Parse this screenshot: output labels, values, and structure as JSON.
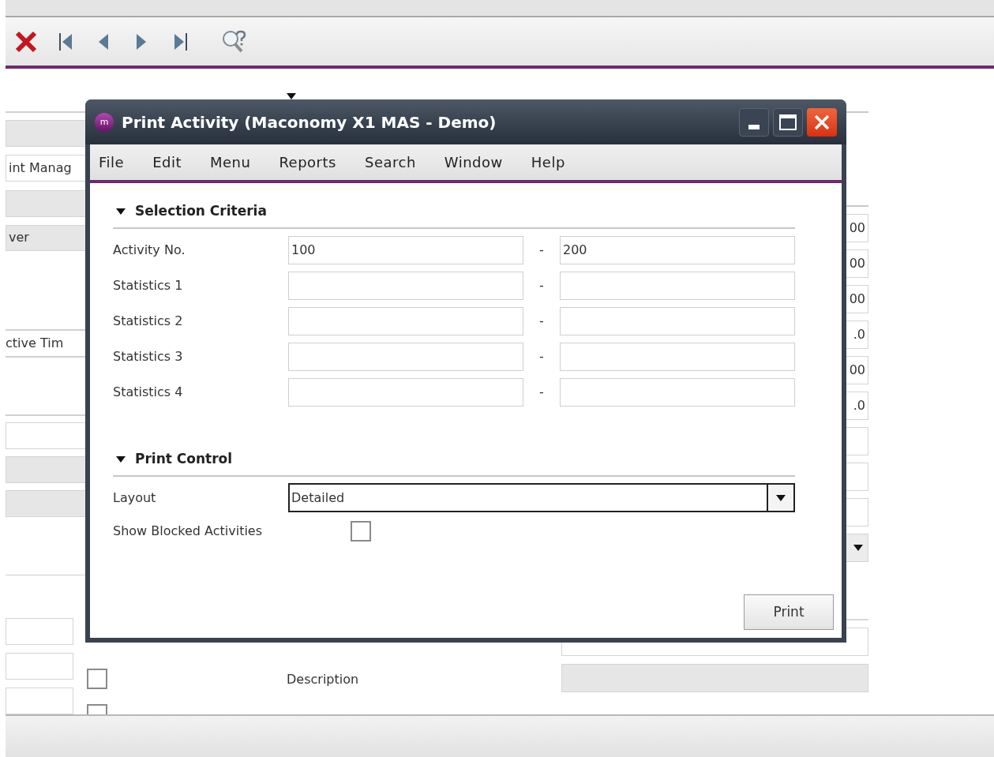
{
  "toolbar": [
    {
      "kind": "delete"
    },
    {
      "kind": "first"
    },
    {
      "kind": "previous"
    },
    {
      "kind": "next"
    },
    {
      "kind": "last"
    },
    {
      "kind": "search_help"
    }
  ],
  "form": {
    "left": [
      {
        "disabled": true
      },
      {
        "value": "int Manag",
        "disabled": false
      },
      {
        "disabled": true
      },
      {
        "value": "ver",
        "disabled": true
      }
    ],
    "left_label": "ctive Tim",
    "left_lower": [
      {
        "disabled": false
      },
      {
        "disabled": true
      },
      {
        "disabled": true
      }
    ],
    "left_bottom": [
      {
        "kind": "field",
        "disabled": false
      },
      {
        "kind": "checkbox_row",
        "disabled": false,
        "checked": false
      },
      {
        "kind": "checkbox_row",
        "disabled": false
      }
    ],
    "right_values": [
      "00",
      "00",
      "00",
      ".0",
      "00",
      ".0"
    ],
    "right_lower": [
      {
        "disabled": false
      },
      {
        "disabled": false
      },
      {
        "disabled": false
      }
    ],
    "labels": [
      {
        "disabled": false
      },
      {
        "text": "Description",
        "disabled": true
      }
    ]
  },
  "dialog": {
    "icon_text": "m",
    "title": "Print Activity (Maconomy X1 MAS - Demo)",
    "menu": [
      "File",
      "Edit",
      "Menu",
      "Reports",
      "Search",
      "Window",
      "Help"
    ],
    "sections": [
      {
        "title": "Selection Criteria",
        "expanded": true,
        "rows": [
          {
            "label": "Activity No.",
            "from": "100",
            "to": "200"
          },
          {
            "label": "Statistics 1"
          },
          {
            "label": "Statistics 2"
          },
          {
            "label": "Statistics 3"
          },
          {
            "label": "Statistics 4"
          }
        ]
      },
      {
        "title": "Print Control",
        "expanded": true
      }
    ],
    "separator": "-",
    "layout": {
      "label": "Layout",
      "value": "Detailed"
    },
    "show_blocked": {
      "label": "Show Blocked Activities",
      "checked": false
    },
    "print_button": "Print"
  }
}
